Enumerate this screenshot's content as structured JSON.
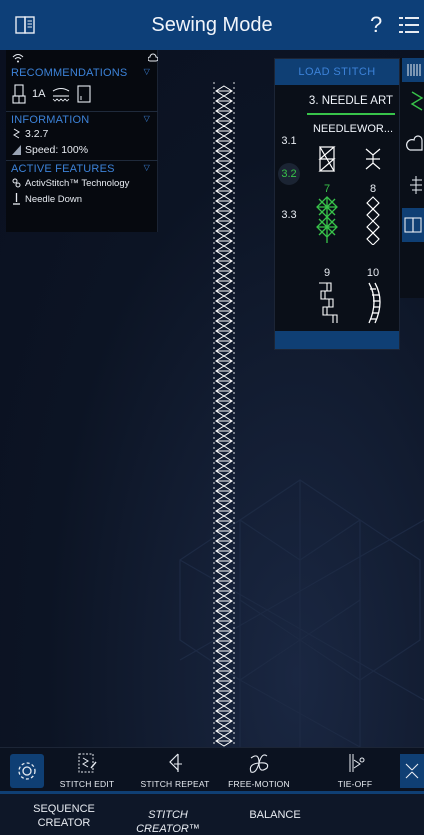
{
  "header": {
    "title": "Sewing Mode",
    "help_label": "?"
  },
  "info_panel": {
    "recommendations_title": "RECOMMENDATIONS",
    "presser_foot": "1A",
    "information_title": "INFORMATION",
    "stitch_number": "3.2.7",
    "speed": "Speed: 100%",
    "active_features_title": "ACTIVE FEATURES",
    "feature_activstitch": "ActivStitch™ Technology",
    "feature_needle": "Needle Down"
  },
  "load_stitch": {
    "title": "LOAD STITCH",
    "category": "3. NEEDLE ART",
    "subcategories": [
      "3.1",
      "3.2",
      "3.3"
    ],
    "selected_subcategory": "3.2",
    "subcategory_name": "NEEDLEWOR...",
    "stitch_numbers": [
      "7",
      "8",
      "9",
      "10"
    ],
    "selected_stitch": "7"
  },
  "bottom_toolbar": {
    "tools": [
      "STITCH EDIT",
      "STITCH REPEAT",
      "FREE-MOTION",
      "TIE-OFF"
    ]
  },
  "tabs": {
    "sequence_creator": "SEQUENCE CREATOR",
    "stitch_creator": "STITCH CREATOR™",
    "balance": "BALANCE"
  },
  "colors": {
    "accent_blue": "#0f3f74",
    "section_blue": "#3c82d8",
    "selected_green": "#38c34a"
  },
  "icons": [
    "guide-book-icon",
    "help-icon",
    "menu-icon",
    "wifi-icon",
    "cloud-icon",
    "presser-foot-icon",
    "stabilizer-icon",
    "stitch-icon",
    "speed-icon",
    "activstitch-icon",
    "needle-down-icon",
    "gear-icon",
    "stitch-edit-icon",
    "stitch-repeat-icon",
    "free-motion-icon",
    "tie-off-icon",
    "expand-icon"
  ]
}
